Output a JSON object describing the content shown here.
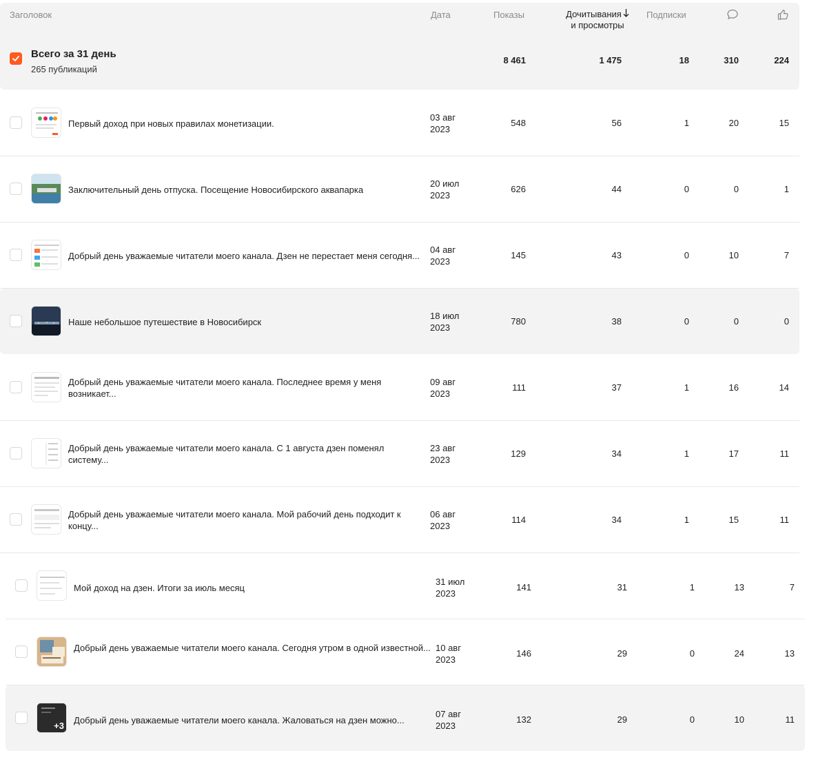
{
  "header": {
    "title": "Заголовок",
    "date": "Дата",
    "views": "Показы",
    "reads_line1": "Дочитывания",
    "reads_line2": "и просмотры",
    "subs": "Подписки",
    "comments_icon": "comment-icon",
    "likes_icon": "like-icon"
  },
  "total": {
    "title": "Всего за 31 день",
    "subtitle": "265 публикаций",
    "views": "8 461",
    "reads": "1 475",
    "subs": "18",
    "comments": "310",
    "likes": "224",
    "checked": true
  },
  "colors": {
    "accent": "#ff5a1f",
    "header_bg": "#f3f3f4",
    "muted": "#8a8a8a"
  },
  "rows": [
    {
      "title": "Первый доход при новых правилах монетизации.",
      "date_line1": "03 авг",
      "date_line2": "2023",
      "views": "548",
      "reads": "56",
      "subs": "1",
      "comments": "20",
      "likes": "15"
    },
    {
      "title": "Заключительный день отпуска. Посещение Новосибирского аквапарка",
      "date_line1": "20 июл",
      "date_line2": "2023",
      "views": "626",
      "reads": "44",
      "subs": "0",
      "comments": "0",
      "likes": "1"
    },
    {
      "title": "Добрый день уважаемые читатели моего канала. Дзен не перестает меня сегодня...",
      "date_line1": "04 авг",
      "date_line2": "2023",
      "views": "145",
      "reads": "43",
      "subs": "0",
      "comments": "10",
      "likes": "7"
    },
    {
      "title": "Наше небольшое путешествие в Новосибирск",
      "date_line1": "18 июл",
      "date_line2": "2023",
      "views": "780",
      "reads": "38",
      "subs": "0",
      "comments": "0",
      "likes": "0"
    },
    {
      "title": "Добрый день уважаемые читатели моего канала. Последнее время у меня возникает...",
      "date_line1": "09 авг",
      "date_line2": "2023",
      "views": "111",
      "reads": "37",
      "subs": "1",
      "comments": "16",
      "likes": "14"
    },
    {
      "title": "Добрый день уважаемые читатели моего канала. С 1 августа дзен поменял систему...",
      "date_line1": "23 авг",
      "date_line2": "2023",
      "views": "129",
      "reads": "34",
      "subs": "1",
      "comments": "17",
      "likes": "11"
    },
    {
      "title": "Добрый день уважаемые читатели моего канала. Мой рабочий день подходит к концу...",
      "date_line1": "06 авг",
      "date_line2": "2023",
      "views": "114",
      "reads": "34",
      "subs": "1",
      "comments": "15",
      "likes": "11"
    },
    {
      "title": "Мой доход на дзен. Итоги за июль месяц",
      "date_line1": "31 июл",
      "date_line2": "2023",
      "views": "141",
      "reads": "31",
      "subs": "1",
      "comments": "13",
      "likes": "7"
    },
    {
      "title": "Добрый день уважаемые читатели моего канала. Сегодня утром в одной известной...",
      "date_line1": "10 авг",
      "date_line2": "2023",
      "views": "146",
      "reads": "29",
      "subs": "0",
      "comments": "24",
      "likes": "13"
    },
    {
      "title": "Добрый день уважаемые читатели моего канала. Жаловаться на дзен можно...",
      "date_line1": "07 авг",
      "date_line2": "2023",
      "views": "132",
      "reads": "29",
      "subs": "0",
      "comments": "10",
      "likes": "11",
      "thumb_badge": "+3"
    }
  ]
}
